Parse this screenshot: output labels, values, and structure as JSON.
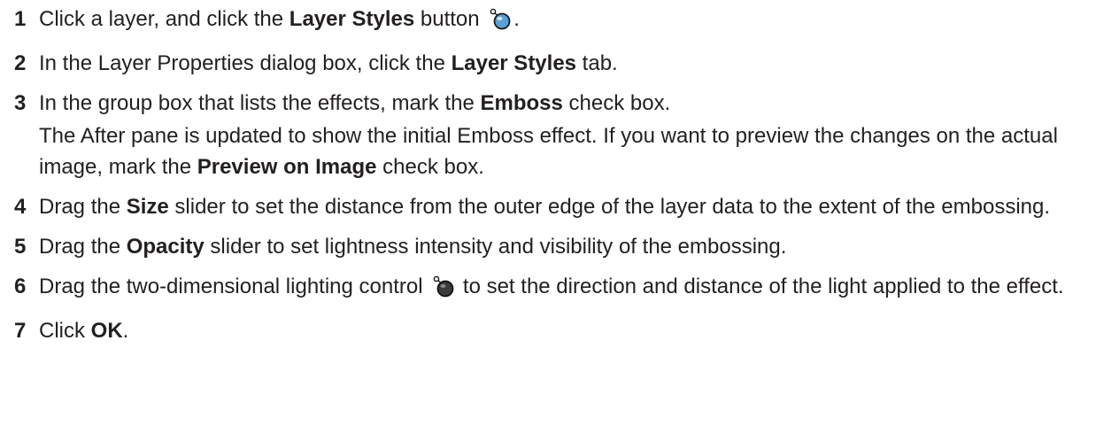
{
  "steps": [
    {
      "num": "1",
      "a": "Click a layer, and click the ",
      "b": "Layer Styles",
      "c": " button",
      "icon": "layer-styles-icon",
      "d": "."
    },
    {
      "num": "2",
      "a": "In the Layer Properties dialog box, click the ",
      "b": "Layer Styles",
      "c": " tab."
    },
    {
      "num": "3",
      "a": "In the group box that lists the effects, mark the ",
      "b": "Emboss",
      "c": " check box."
    },
    {
      "note_a": "The After pane is updated to show the initial Emboss effect. If you want to preview the changes on the actual image, mark the ",
      "note_b": "Preview on Image",
      "note_c": " check box."
    },
    {
      "num": "4",
      "a": "Drag the ",
      "b": "Size",
      "c": " slider to set the distance from the outer edge of the layer data to the extent of the embossing."
    },
    {
      "num": "5",
      "a": "Drag the ",
      "b": "Opacity",
      "c": " slider to set lightness intensity and visibility of the embossing."
    },
    {
      "num": "6",
      "a": "Drag the two-dimensional lighting control",
      "icon": "lighting-control-icon",
      "c": " to set the direction and distance of the light applied to the effect."
    },
    {
      "num": "7",
      "a": "Click ",
      "b": "OK",
      "c": "."
    }
  ],
  "colors": {
    "text": "#231f20",
    "icon_blue": "#5aa0d8",
    "icon_dark": "#222222"
  }
}
